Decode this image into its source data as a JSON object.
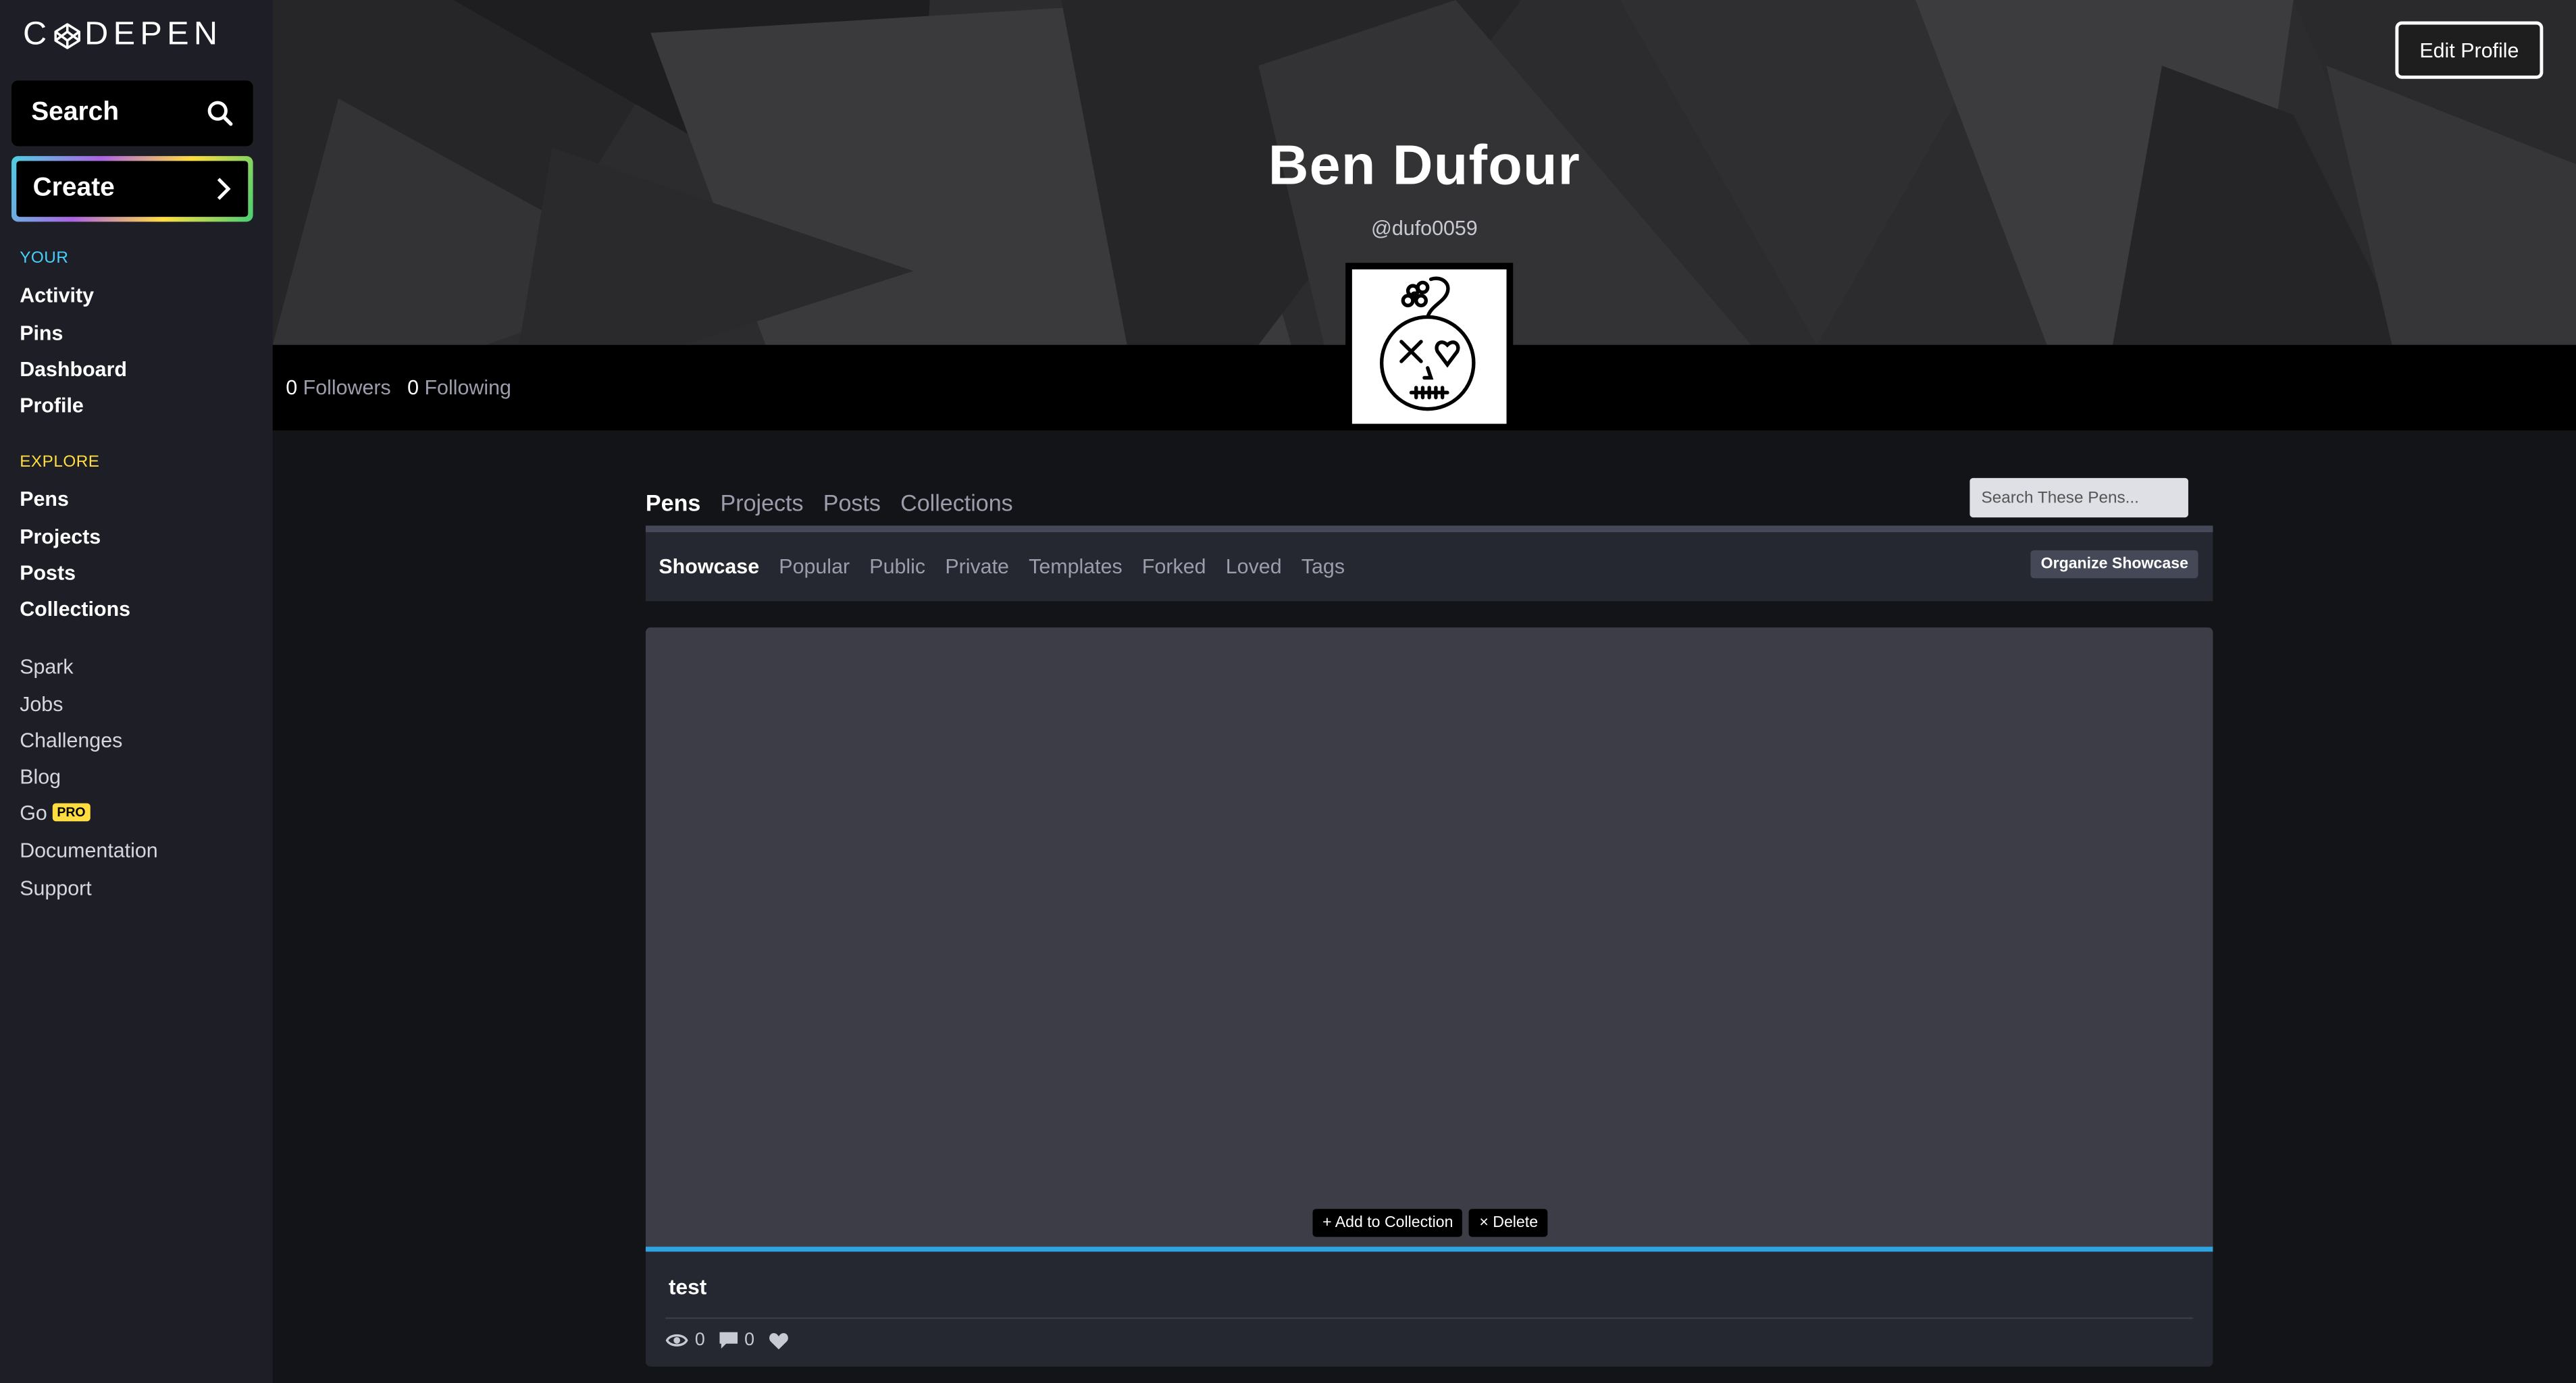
{
  "brand": {
    "name": "CODEPEN"
  },
  "sidebar": {
    "search_label": "Search",
    "create_label": "Create",
    "your_heading": "YOUR",
    "your_items": [
      "Activity",
      "Pins",
      "Dashboard",
      "Profile"
    ],
    "explore_heading": "EXPLORE",
    "explore_items": [
      "Pens",
      "Projects",
      "Posts",
      "Collections"
    ],
    "other_items": [
      "Spark",
      "Jobs",
      "Challenges",
      "Blog",
      "Go",
      "Documentation",
      "Support"
    ],
    "pro_badge": "PRO",
    "colors": {
      "your_heading": "#47cfff",
      "explore_heading": "#ffdd40"
    }
  },
  "header": {
    "edit_profile": "Edit Profile",
    "name": "Ben Dufour",
    "handle": "@dufo0059"
  },
  "stats": {
    "followers_count": "0",
    "followers_label": "Followers",
    "following_count": "0",
    "following_label": "Following"
  },
  "tabs": [
    "Pens",
    "Projects",
    "Posts",
    "Collections"
  ],
  "search_pens": {
    "placeholder": "Search These Pens..."
  },
  "subtabs": [
    "Showcase",
    "Popular",
    "Public",
    "Private",
    "Templates",
    "Forked",
    "Loved",
    "Tags"
  ],
  "organize_label": "Organize Showcase",
  "pen": {
    "title": "test",
    "add_to_collection": "+ Add to Collection",
    "delete": "× Delete",
    "views": "0",
    "comments": "0"
  },
  "icons": [
    "codepen-logo-icon",
    "search-icon",
    "chevron-right-icon",
    "eye-icon",
    "comment-icon",
    "heart-icon"
  ]
}
